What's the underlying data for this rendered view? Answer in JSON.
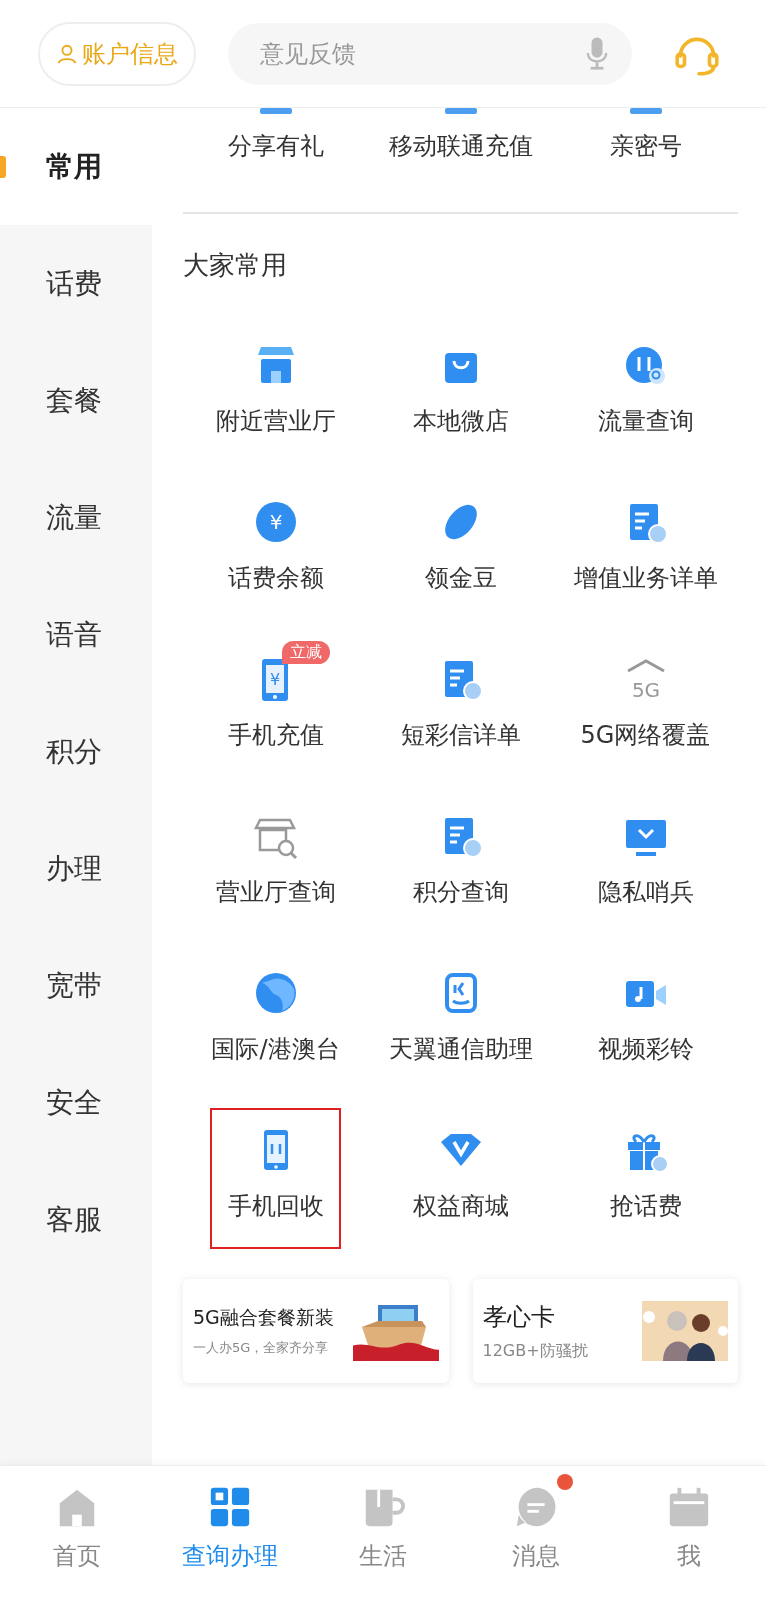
{
  "header": {
    "account_button": "账户信息",
    "search": {
      "placeholder": "意见反馈"
    }
  },
  "sidebar": {
    "items": [
      {
        "label": "常用",
        "selected": true
      },
      {
        "label": "话费",
        "selected": false
      },
      {
        "label": "套餐",
        "selected": false
      },
      {
        "label": "流量",
        "selected": false
      },
      {
        "label": "语音",
        "selected": false
      },
      {
        "label": "积分",
        "selected": false
      },
      {
        "label": "办理",
        "selected": false
      },
      {
        "label": "宽带",
        "selected": false
      },
      {
        "label": "安全",
        "selected": false
      },
      {
        "label": "客服",
        "selected": false
      }
    ]
  },
  "top_row": [
    {
      "label": "分享有礼"
    },
    {
      "label": "移动联通充值"
    },
    {
      "label": "亲密号"
    }
  ],
  "section": {
    "title": "大家常用",
    "items": [
      {
        "label": "附近营业厅",
        "highlighted": false
      },
      {
        "label": "本地微店",
        "highlighted": false
      },
      {
        "label": "流量查询",
        "highlighted": false
      },
      {
        "label": "话费余额",
        "icon_text": "¥",
        "highlighted": false
      },
      {
        "label": "领金豆",
        "highlighted": false
      },
      {
        "label": "增值业务详单",
        "highlighted": false
      },
      {
        "label": "手机充值",
        "icon_text": "¥",
        "badge": "立减",
        "highlighted": false
      },
      {
        "label": "短彩信详单",
        "highlighted": false
      },
      {
        "label": "5G网络覆盖",
        "icon_text": "5G",
        "highlighted": false
      },
      {
        "label": "营业厅查询",
        "highlighted": false
      },
      {
        "label": "积分查询",
        "highlighted": false
      },
      {
        "label": "隐私哨兵",
        "highlighted": false
      },
      {
        "label": "国际/港澳台",
        "highlighted": false
      },
      {
        "label": "天翼通信助理",
        "highlighted": false
      },
      {
        "label": "视频彩铃",
        "highlighted": false
      },
      {
        "label": "手机回收",
        "highlighted": true
      },
      {
        "label": "权益商城",
        "highlighted": false
      },
      {
        "label": "抢话费",
        "highlighted": false
      }
    ]
  },
  "banners": [
    {
      "title": "5G融合套餐新装",
      "subtitle": "一人办5G，全家齐分享",
      "kind": "picture"
    },
    {
      "title": "孝心卡",
      "subtitle": "12GB+防骚扰",
      "kind": "picture"
    }
  ],
  "bottom_nav": [
    {
      "label": "首页",
      "selected": false,
      "badge_dot": false
    },
    {
      "label": "查询办理",
      "selected": true,
      "badge_dot": false
    },
    {
      "label": "生活",
      "selected": false,
      "badge_dot": false
    },
    {
      "label": "消息",
      "selected": false,
      "badge_dot": true
    },
    {
      "label": "我",
      "selected": false,
      "badge_dot": false
    }
  ]
}
